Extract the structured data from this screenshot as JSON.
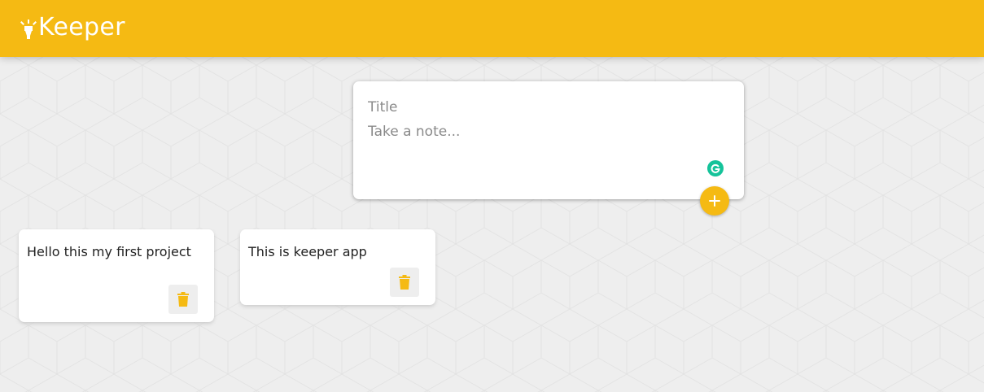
{
  "header": {
    "app_title": "Keeper",
    "brand_color": "#f5ba13",
    "logo_icon": "highlight-lightbulb-icon"
  },
  "create_note": {
    "title_placeholder": "Title",
    "content_placeholder": "Take a note...",
    "add_icon": "add-icon",
    "grammarly_icon": "grammarly-icon"
  },
  "notes": [
    {
      "content": "Hello this my first project",
      "delete_icon": "delete-icon"
    },
    {
      "content": "This is keeper app",
      "delete_icon": "delete-icon"
    }
  ],
  "colors": {
    "background": "#eeeeee",
    "accent": "#f5ba13",
    "grammarly": "#15c39a"
  }
}
